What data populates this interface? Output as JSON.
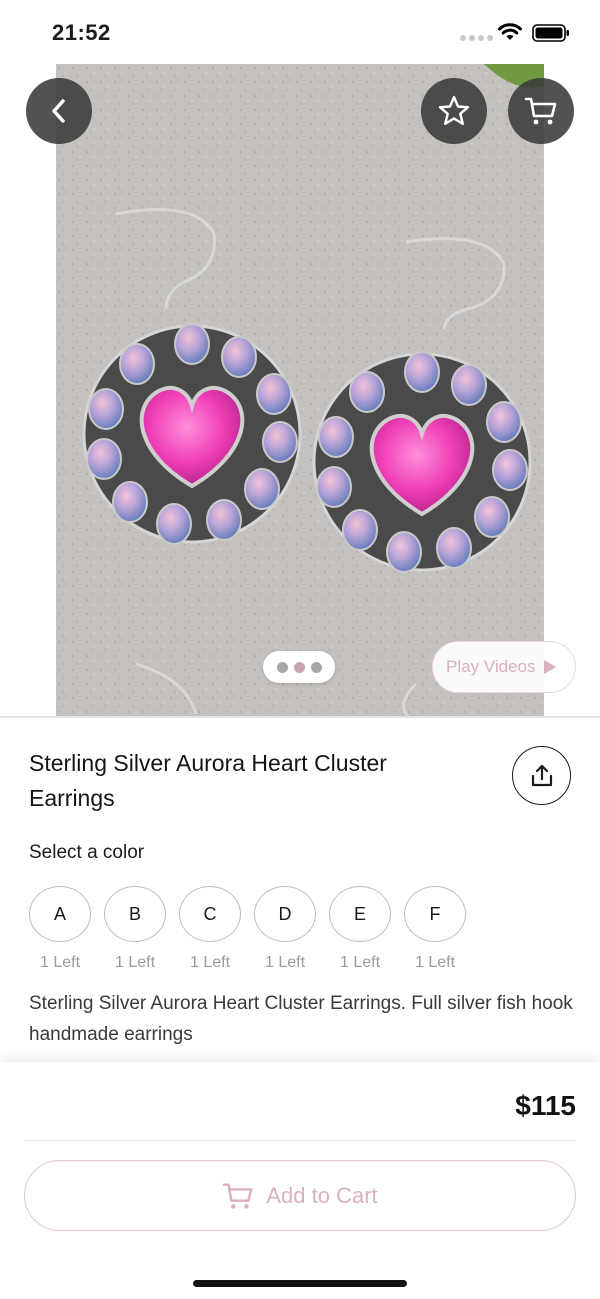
{
  "status_bar": {
    "time": "21:52"
  },
  "product": {
    "title": "Sterling Silver Aurora Heart Cluster Earrings",
    "description": "Sterling Silver Aurora Heart Cluster Earrings. Full silver fish hook handmade earrings",
    "price": "$115",
    "image_pages": 3,
    "active_image_index": 1
  },
  "hero": {
    "play_videos_label": "Play Videos",
    "icons": {
      "back": "chevron-left-icon",
      "favorite": "star-icon",
      "cart": "cart-icon",
      "play": "play-icon"
    }
  },
  "variants": {
    "label": "Select a color",
    "options": [
      {
        "letter": "A",
        "stock": "1 Left"
      },
      {
        "letter": "B",
        "stock": "1 Left"
      },
      {
        "letter": "C",
        "stock": "1 Left"
      },
      {
        "letter": "D",
        "stock": "1 Left"
      },
      {
        "letter": "E",
        "stock": "1 Left"
      },
      {
        "letter": "F",
        "stock": "1 Left"
      }
    ]
  },
  "actions": {
    "add_to_cart_label": "Add to Cart"
  },
  "colors": {
    "accent_pink": "#d9b0c1",
    "accent_border": "#e3c7d2",
    "overlay_button": "#3a3a3a",
    "text_primary": "#151515",
    "text_muted": "#9b9b9b"
  }
}
